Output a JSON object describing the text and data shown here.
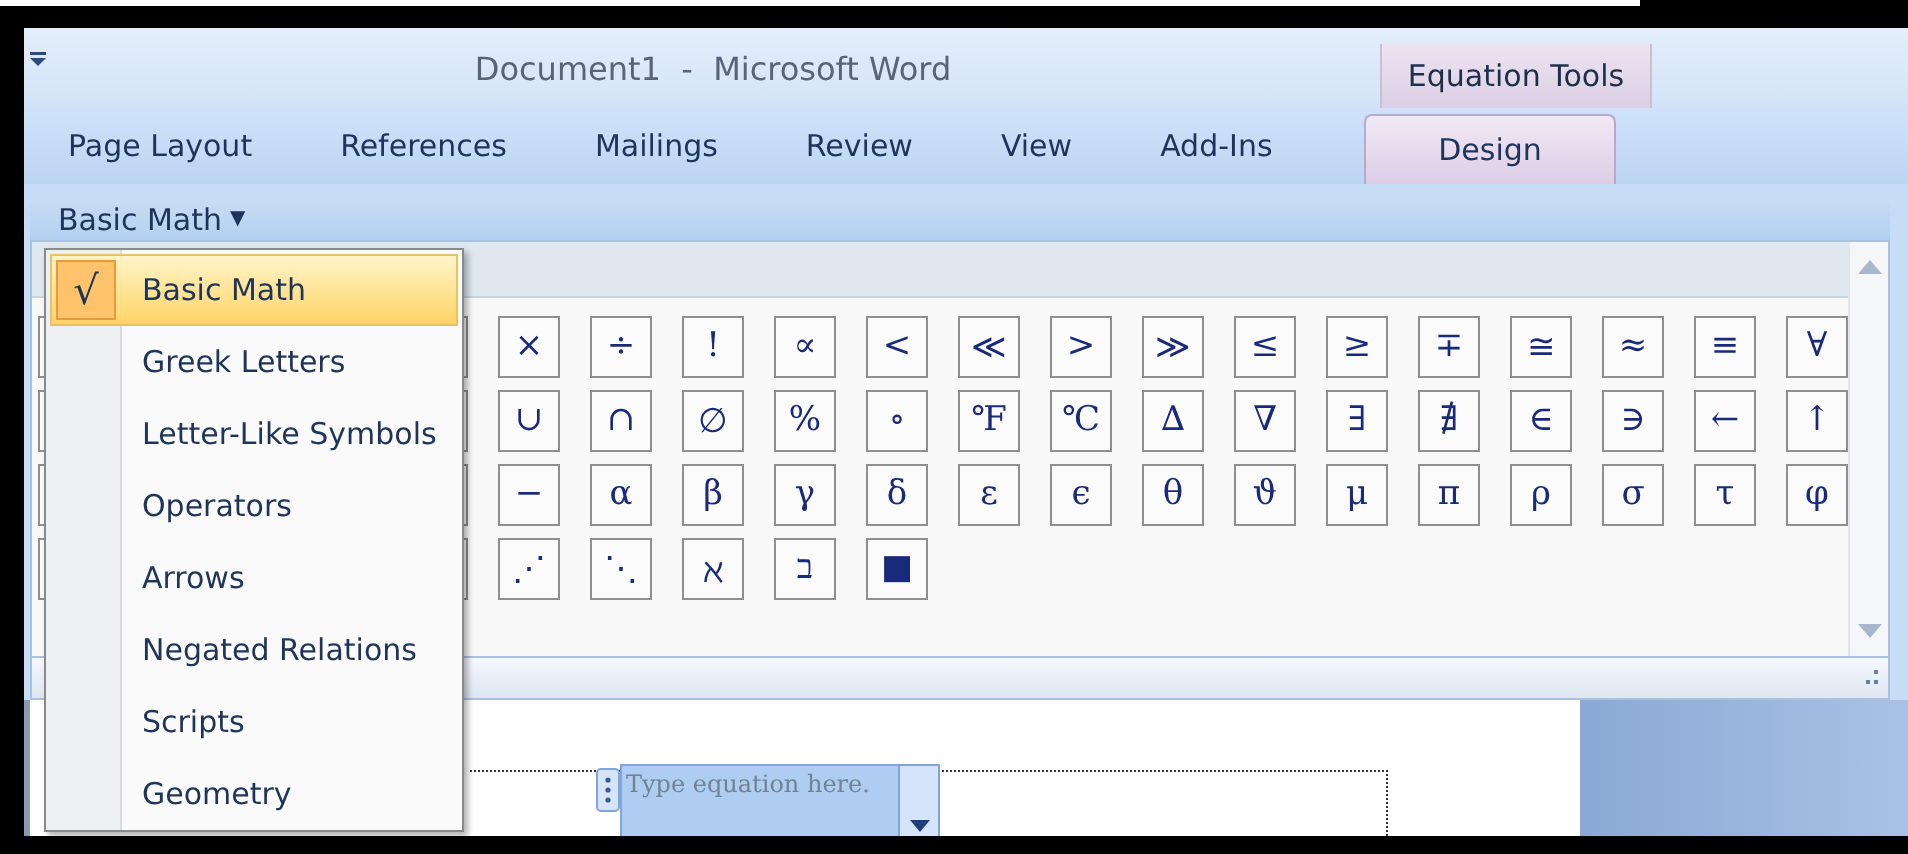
{
  "window": {
    "title": "Document1  -  Microsoft Word",
    "contextual_group": "Equation Tools"
  },
  "tabs": [
    {
      "label": "Page Layout",
      "selected": false
    },
    {
      "label": "References",
      "selected": false
    },
    {
      "label": "Mailings",
      "selected": false
    },
    {
      "label": "Review",
      "selected": false
    },
    {
      "label": "View",
      "selected": false
    },
    {
      "label": "Add-Ins",
      "selected": false
    },
    {
      "label": "Design",
      "selected": true
    }
  ],
  "gallery": {
    "category": "Basic Math",
    "caret": "▼",
    "menu": [
      {
        "label": "Basic Math",
        "selected": true,
        "check": "√"
      },
      {
        "label": "Greek Letters",
        "selected": false
      },
      {
        "label": "Letter-Like Symbols",
        "selected": false
      },
      {
        "label": "Operators",
        "selected": false
      },
      {
        "label": "Arrows",
        "selected": false
      },
      {
        "label": "Negated Relations",
        "selected": false
      },
      {
        "label": "Scripts",
        "selected": false
      },
      {
        "label": "Geometry",
        "selected": false
      }
    ],
    "symbol_rows": [
      [
        "×",
        "÷",
        "!",
        "∝",
        "<",
        "≪",
        ">",
        "≫",
        "≤",
        "≥",
        "∓",
        "≅",
        "≈",
        "≡",
        "∀"
      ],
      [
        "∪",
        "∩",
        "∅",
        "%",
        "∘",
        "℉",
        "℃",
        "∆",
        "∇",
        "∃",
        "∄",
        "∈",
        "∋",
        "←",
        "↑"
      ],
      [
        "−",
        "α",
        "β",
        "γ",
        "δ",
        "ε",
        "ϵ",
        "θ",
        "ϑ",
        "μ",
        "π",
        "ρ",
        "σ",
        "τ",
        "φ"
      ],
      [
        "⋰",
        "⋱",
        "ℵ",
        "ב",
        "■"
      ]
    ]
  },
  "document": {
    "equation": {
      "placeholder": "Type equation here."
    }
  }
}
